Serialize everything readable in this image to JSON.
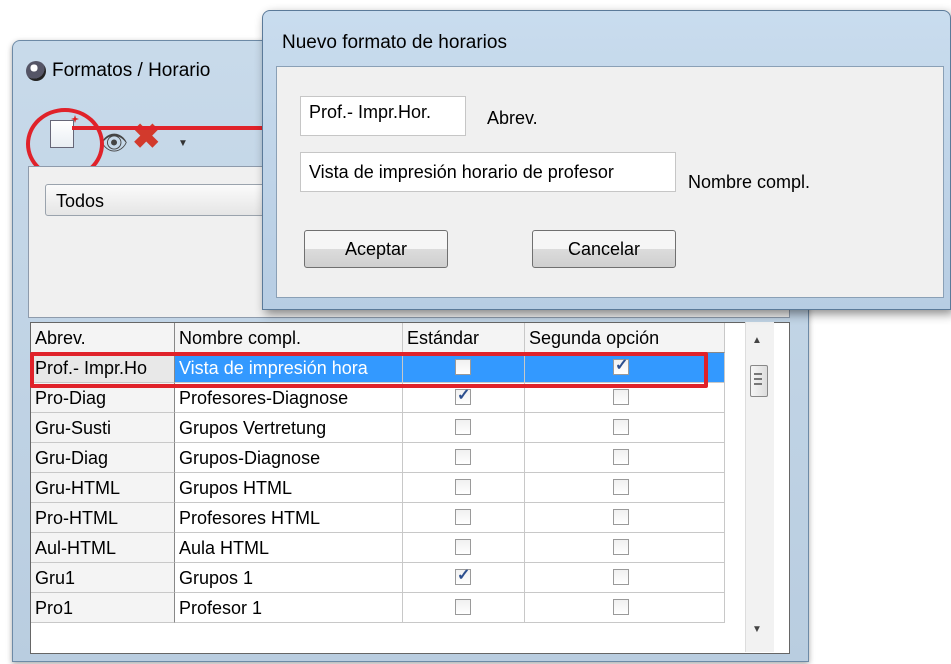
{
  "back_window": {
    "title": "Formatos / Horario",
    "filter_value": "Todos"
  },
  "toolbar": {
    "icons": [
      "new-format-icon",
      "eye-icon",
      "delete-icon",
      "dropdown-icon"
    ]
  },
  "grid": {
    "headers": [
      "Abrev.",
      "Nombre compl.",
      "Estándar",
      "Segunda opción"
    ],
    "rows": [
      {
        "abrev": "Prof.- Impr.Ho",
        "name": "Vista de impresión hora",
        "standard": false,
        "second": true,
        "selected": true
      },
      {
        "abrev": "Pro-Diag",
        "name": "Profesores-Diagnose",
        "standard": true,
        "second": false
      },
      {
        "abrev": "Gru-Susti",
        "name": "Grupos Vertretung",
        "standard": false,
        "second": false
      },
      {
        "abrev": "Gru-Diag",
        "name": "Grupos-Diagnose",
        "standard": false,
        "second": false
      },
      {
        "abrev": "Gru-HTML",
        "name": "Grupos HTML",
        "standard": false,
        "second": false
      },
      {
        "abrev": "Pro-HTML",
        "name": "Profesores HTML",
        "standard": false,
        "second": false
      },
      {
        "abrev": "Aul-HTML",
        "name": "Aula HTML",
        "standard": false,
        "second": false
      },
      {
        "abrev": "Gru1",
        "name": "Grupos 1",
        "standard": true,
        "second": false
      },
      {
        "abrev": "Pro1",
        "name": "Profesor 1",
        "standard": false,
        "second": false
      }
    ]
  },
  "dialog": {
    "title": "Nuevo formato de horarios",
    "abrev_value": "Prof.- Impr.Hor.",
    "abrev_label": "Abrev.",
    "name_value": "Vista de impresión horario de profesor",
    "name_label": "Nombre compl.",
    "ok_label": "Aceptar",
    "cancel_label": "Cancelar"
  },
  "colors": {
    "highlight": "#e0222a",
    "selection": "#3399ff"
  }
}
